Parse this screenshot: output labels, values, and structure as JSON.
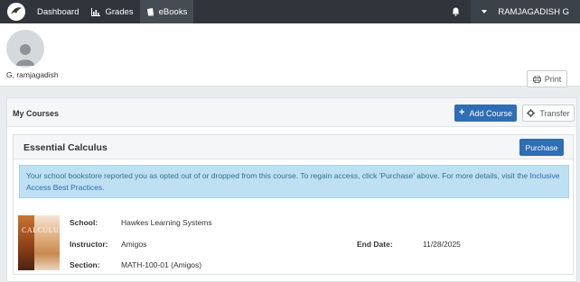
{
  "nav": {
    "items": [
      {
        "label": "Dashboard",
        "icon": "dashboard-icon"
      },
      {
        "label": "Grades",
        "icon": "bar-chart-icon"
      },
      {
        "label": "eBooks",
        "icon": "book-icon"
      }
    ],
    "bell_icon": "bell-icon",
    "user_name": "RAMJAGADISH G"
  },
  "profile": {
    "name": "G, ramjagadish",
    "print_label": "Print"
  },
  "courses": {
    "title": "My Courses",
    "add_label": "Add Course",
    "transfer_label": "Transfer"
  },
  "course": {
    "title": "Essential Calculus",
    "purchase_label": "Purchase",
    "alert_text": "Your school bookstore reported you as opted out of or dropped from this course. To regain access, click 'Purchase' above. For more details, visit the ",
    "alert_link": "Inclusive Access Best Practices",
    "alert_end": ".",
    "book_cover_text": "CALCULUS",
    "school_label": "School:",
    "school": "Hawkes Learning Systems",
    "instructor_label": "Instructor:",
    "instructor": "Amigos",
    "end_date_label": "End Date:",
    "end_date": "11/28/2025",
    "section_label": "Section:",
    "section": "MATH-100-01 (Amigos)"
  },
  "colors": {
    "navbar": "#2f353b",
    "primary": "#2f6db5",
    "alert_bg": "#bfe0f3",
    "alert_text": "#31708f"
  }
}
